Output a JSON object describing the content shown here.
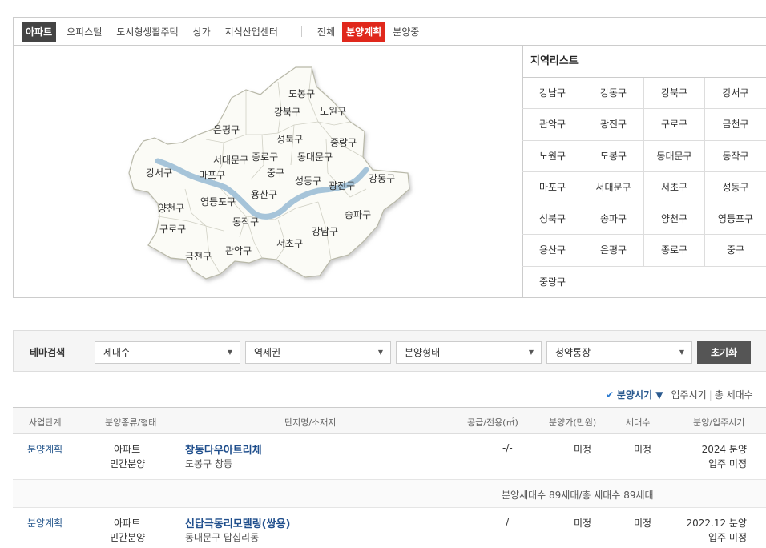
{
  "tabs": {
    "types": [
      "아파트",
      "오피스텔",
      "도시형생활주택",
      "상가",
      "지식산업센터"
    ],
    "statuses": [
      "전체",
      "분양계획",
      "분양중"
    ]
  },
  "map": {
    "districts": [
      {
        "name": "도봉구"
      },
      {
        "name": "강북구"
      },
      {
        "name": "노원구"
      },
      {
        "name": "은평구"
      },
      {
        "name": "성북구"
      },
      {
        "name": "중랑구"
      },
      {
        "name": "서대문구"
      },
      {
        "name": "종로구"
      },
      {
        "name": "동대문구"
      },
      {
        "name": "강서구"
      },
      {
        "name": "마포구"
      },
      {
        "name": "중구"
      },
      {
        "name": "성동구"
      },
      {
        "name": "광진구"
      },
      {
        "name": "강동구"
      },
      {
        "name": "용산구"
      },
      {
        "name": "양천구"
      },
      {
        "name": "영등포구"
      },
      {
        "name": "동작구"
      },
      {
        "name": "송파구"
      },
      {
        "name": "구로구"
      },
      {
        "name": "강남구"
      },
      {
        "name": "서초구"
      },
      {
        "name": "관악구"
      },
      {
        "name": "금천구"
      }
    ]
  },
  "region_list": {
    "title": "지역리스트",
    "items": [
      "강남구",
      "강동구",
      "강북구",
      "강서구",
      "관악구",
      "광진구",
      "구로구",
      "금천구",
      "노원구",
      "도봉구",
      "동대문구",
      "동작구",
      "마포구",
      "서대문구",
      "서초구",
      "성동구",
      "성북구",
      "송파구",
      "양천구",
      "영등포구",
      "용산구",
      "은평구",
      "종로구",
      "중구",
      "중랑구"
    ]
  },
  "filter": {
    "label": "테마검색",
    "selects": [
      "세대수",
      "역세권",
      "분양형태",
      "청약통장"
    ],
    "reset_label": "초기화"
  },
  "sort": {
    "active": "분양시기",
    "options": [
      "입주시기",
      "총 세대수"
    ]
  },
  "table": {
    "headers": [
      "사업단계",
      "분양종류/형태",
      "단지명/소재지",
      "공급/전용(㎡)",
      "분양가(만원)",
      "세대수",
      "분양/입주시기"
    ],
    "rows": [
      {
        "stage": "분양계획",
        "kind": "아파트",
        "form": "민간분양",
        "name": "창동다우아트리체",
        "loc": "도봉구 창동",
        "area": "-/-",
        "price": "미정",
        "units": "미정",
        "sale": "2024 분양",
        "move": "입주 미정"
      },
      {
        "stage": "분양계획",
        "kind": "아파트",
        "form": "민간분양",
        "name": "신답극동리모델링(쌍용)",
        "loc": "동대문구 답십리동",
        "area": "-/-",
        "price": "미정",
        "units": "미정",
        "sale": "2022.12 분양",
        "move": "입주 미정"
      }
    ],
    "summary": "분양세대수 89세대/총 세대수 89세대"
  }
}
